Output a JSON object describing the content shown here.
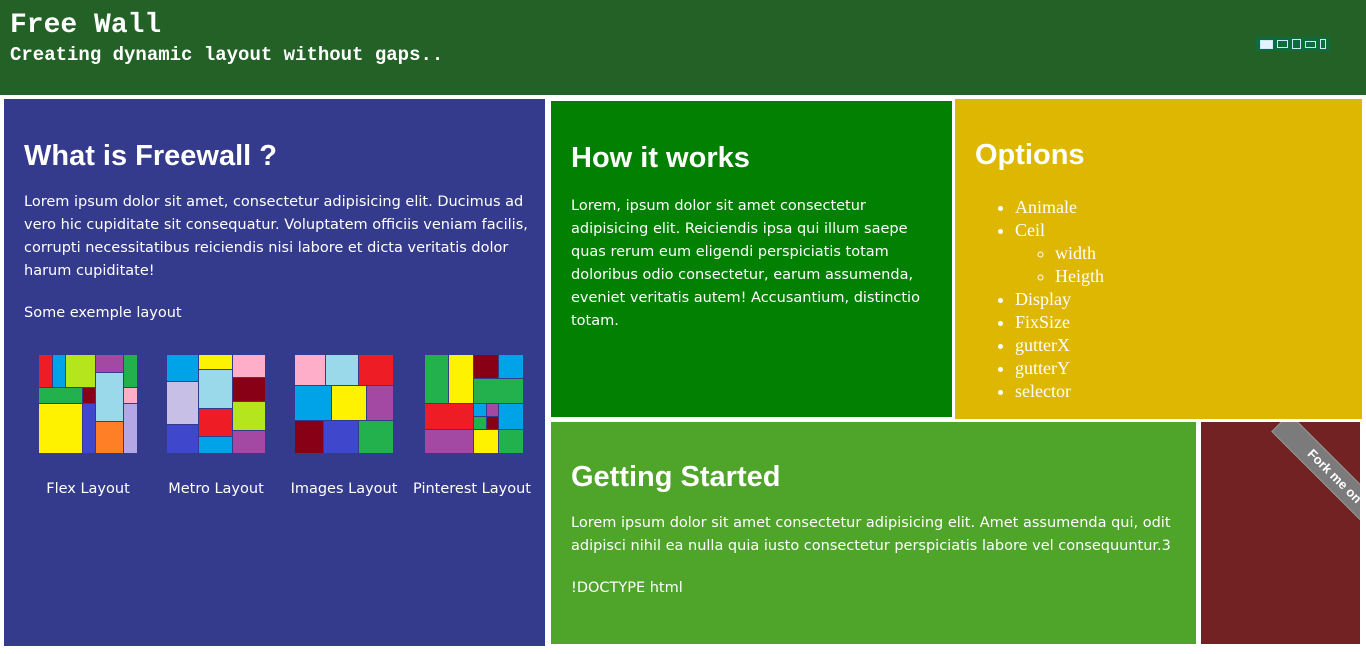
{
  "header": {
    "title": "Free Wall",
    "subtitle": "Creating dynamic layout without gaps..",
    "device_icons": [
      "monitor-icon",
      "laptop-icon",
      "tablet-icon",
      "tablet-landscape-icon",
      "phone-icon"
    ]
  },
  "what": {
    "heading": "What is Freewall ?",
    "paragraph": "Lorem ipsum dolor sit amet, consectetur adipisicing elit. Ducimus ad vero hic cupiditate sit consequatur. Voluptatem officiis veniam facilis, corrupti necessitatibus reiciendis nisi labore et dicta veritatis dolor harum cupiditate!",
    "example_label": "Some exemple layout",
    "layouts": [
      {
        "label": "Flex Layout"
      },
      {
        "label": "Metro Layout"
      },
      {
        "label": "Images Layout"
      },
      {
        "label": "Pinterest Layout"
      }
    ]
  },
  "how": {
    "heading": "How it works",
    "paragraph": "Lorem, ipsum dolor sit amet consectetur adipisicing elit. Reiciendis ipsa qui illum saepe quas rerum eum eligendi perspiciatis totam doloribus odio consectetur, earum assumenda, eveniet veritatis autem! Accusantium, distinctio totam."
  },
  "options": {
    "heading": "Options",
    "items": [
      "Animale",
      "Ceil",
      "Display",
      "FixSize",
      "gutterX",
      "gutterY",
      "selector"
    ],
    "ceil_sub": [
      "width",
      "Heigth"
    ]
  },
  "started": {
    "heading": "Getting Started",
    "paragraph": "Lorem ipsum dolor sit amet consectetur adipisicing elit. Amet assumenda qui, odit adipisci nihil ea nulla quia iusto consectetur perspiciatis labore vel consequuntur.3",
    "doctype": "!DOCTYPE html"
  },
  "fork": {
    "label": "Fork me on GitHub"
  },
  "colors": {
    "header": "#236126",
    "what": "#353b8c",
    "how": "#018001",
    "options": "#ddb702",
    "started": "#4fa42a",
    "fork": "#722222"
  }
}
